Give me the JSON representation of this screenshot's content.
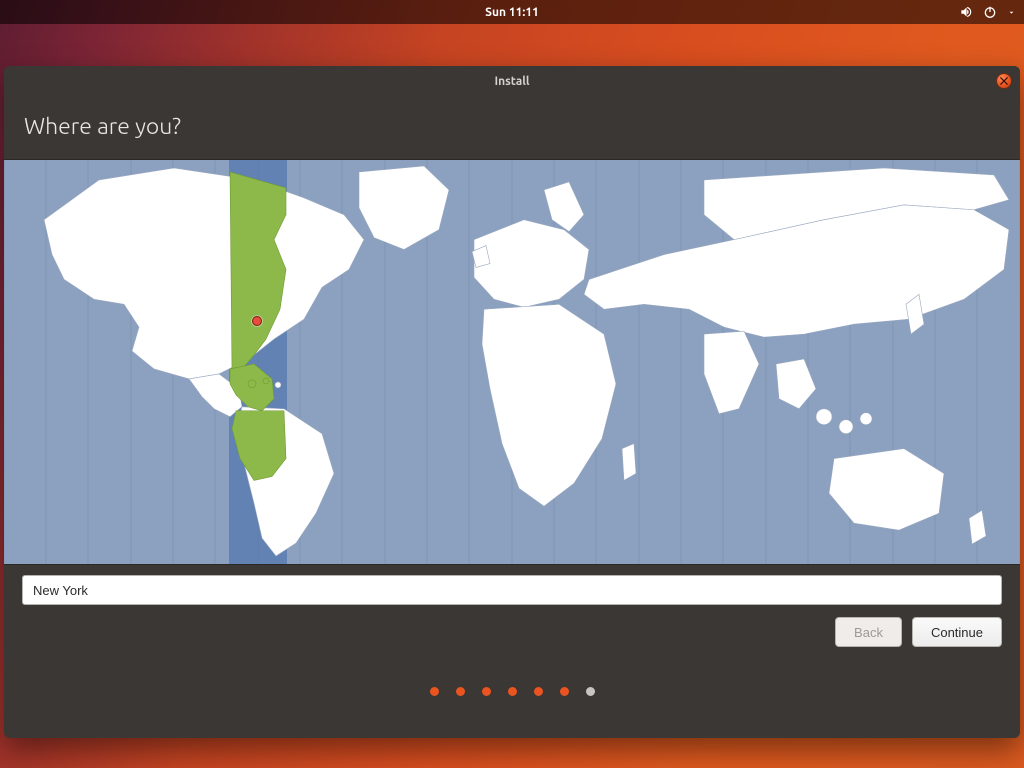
{
  "panel": {
    "clock": "Sun 11:11"
  },
  "window": {
    "title": "Install",
    "heading": "Where are you?",
    "timezone_value": "New York",
    "buttons": {
      "back": "Back",
      "continue": "Continue"
    }
  },
  "progress": {
    "total": 7,
    "current": 6
  },
  "map": {
    "pin_label": "New York",
    "highlighted_zone": "UTC-05 (US Eastern)"
  },
  "colors": {
    "accent": "#e95420",
    "map_sea": "#8ca0c0",
    "map_land": "#ffffff",
    "map_highlight": "#8db94b",
    "window_bg": "#3b3735"
  }
}
